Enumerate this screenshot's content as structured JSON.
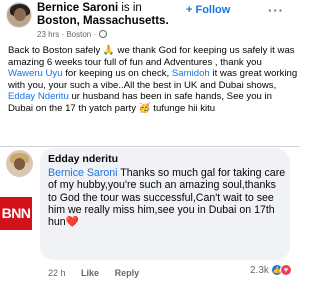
{
  "post": {
    "author": "Bernice Saroni",
    "location_prefix": " is in ",
    "location": "Boston, Massachusetts.",
    "follow_label": "Follow",
    "more_label": "···",
    "time": "23 hrs",
    "place": "Boston",
    "text_1": "Back to Boston safely 🙏 we  thank God for keeping us safely it was amazing  6 weeks tour full of fun and Adventures , thank you ",
    "mention_1": "Waweru Uyu",
    "text_2": " for keeping us on check, ",
    "mention_2": "Samidoh",
    "text_3": " it was great working with you, your such a vibe..All the best in UK and Dubai shows, ",
    "mention_3": "Edday Nderitu",
    "text_4": " ur husband has been in safe hands, See you in  Dubai on the 17 th yatch party 🥳 tufunge hii kitu"
  },
  "comment": {
    "author": "Edday nderitu",
    "mention": "Bernice Saroni",
    "text": " Thanks so much gal for taking care of my hubby,you're such an amazing soul,thanks to God the tour was successful,Can't wait to see him we really miss him,see you in Dubai on 17th hun❤️",
    "time": "22 h",
    "like_label": "Like",
    "reply_label": "Reply",
    "reaction_count": "2.3k"
  },
  "watermark": {
    "logo_text": "BNN"
  },
  "icons": {
    "globe": "globe-icon",
    "like": "like-icon",
    "love": "love-icon",
    "more": "more-icon"
  },
  "colors": {
    "link": "#1b74e4",
    "bubble": "#f0f2f5",
    "logo_red": "#d1121a",
    "meta_gray": "#65676b"
  }
}
